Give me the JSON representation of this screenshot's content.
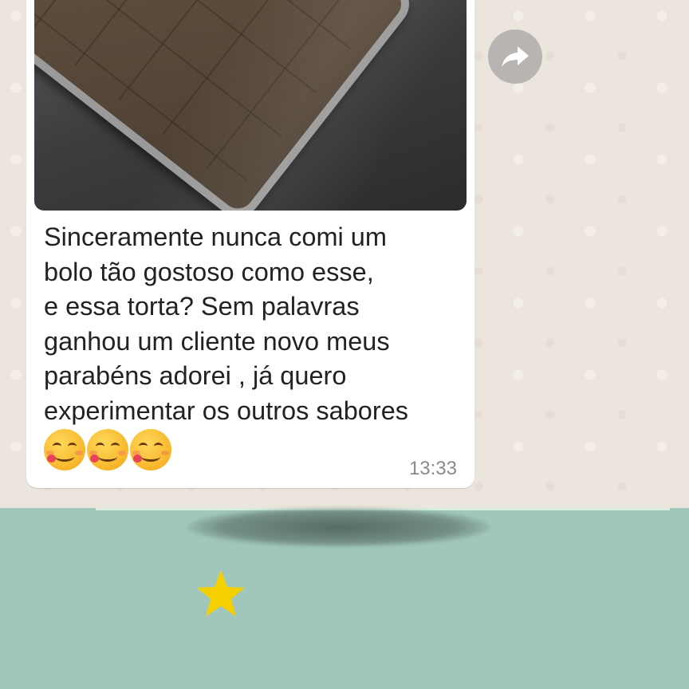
{
  "message": {
    "text": "Sinceramente nunca comi um\nbolo tão gostoso como esse,\ne essa torta? Sem palavras\nganhou um cliente novo meus\nparabéns adorei , já quero\nexperimentar os outros sabores",
    "emojis": [
      "savoring-food-emoji",
      "savoring-food-emoji",
      "savoring-food-emoji"
    ],
    "timestamp": "13:33"
  },
  "forward_icon": "forward-arrow-icon",
  "decoration": {
    "star_icon": "star-icon",
    "star_color": "#f5d000"
  },
  "colors": {
    "chat_background": "#ece5dd",
    "bubble": "#ffffff",
    "bottom_panel": "#a1c7bc"
  }
}
